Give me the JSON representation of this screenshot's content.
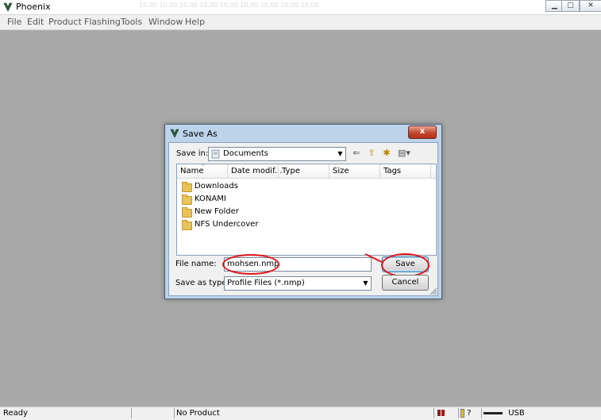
{
  "app": {
    "title": "Phoenix",
    "ghost_toolbar": "10,00  10,00  10,00  10,00  10,00  10,00  10,00  10,00  10,00"
  },
  "window_controls": {
    "minimize": "▁",
    "maximize": "▢",
    "close": "✕"
  },
  "menu": [
    "File",
    "Edit",
    "Product",
    "Flashing",
    "Tools",
    "Window",
    "Help"
  ],
  "dialog": {
    "title": "Save As",
    "close_glyph": "x",
    "save_in_label": "Save in:",
    "save_in_value": "Documents",
    "toolbar_icons": [
      "back-arrow-icon",
      "up-folder-icon",
      "new-folder-icon",
      "view-menu-icon"
    ],
    "columns": [
      "Name",
      "Date modif...",
      "Type",
      "Size",
      "Tags"
    ],
    "items": [
      "Downloads",
      "KONAMI",
      "New Folder",
      "NFS Undercover"
    ],
    "file_name_label": "File name:",
    "file_name_value": "mohsen.nmp",
    "save_type_label": "Save as type:",
    "save_type_value": "Profile Files (*.nmp)",
    "save_button": "Save",
    "cancel_button": "Cancel"
  },
  "statusbar": {
    "ready": "Ready",
    "product": "No Product",
    "usb": "USB",
    "help_glyph": "?"
  },
  "colors": {
    "annotation_red": "#e0151b",
    "workspace": "#a9a9a9",
    "dialog_frame": "#bcd3ea"
  }
}
